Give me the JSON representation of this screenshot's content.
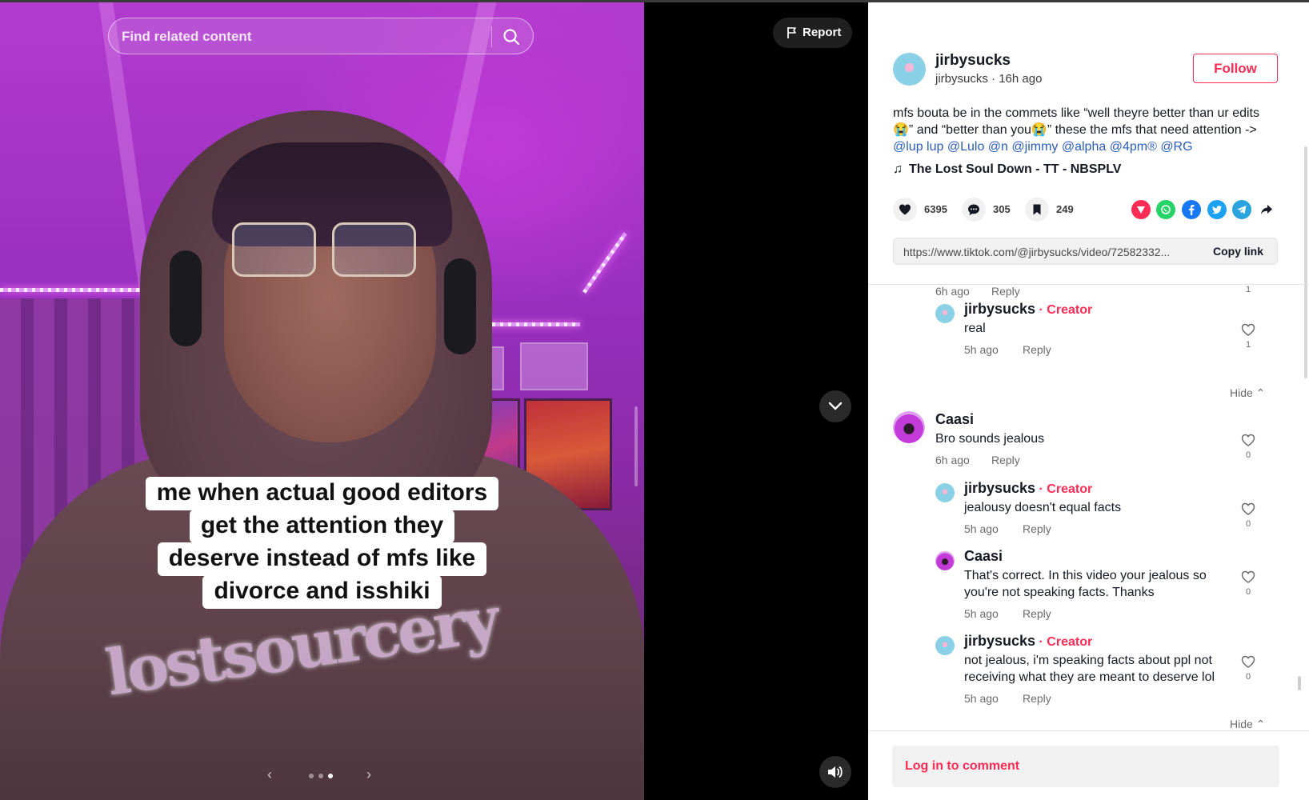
{
  "video": {
    "search_placeholder": "Find related content",
    "report_label": "Report",
    "caption_lines": [
      "me when actual good editors",
      "get the attention they",
      "deserve instead of mfs like",
      "divorce and isshiki"
    ],
    "hoodie_print": "lostsourcery",
    "photo_index": 3,
    "photo_count": 3
  },
  "post": {
    "author_name": "jirbysucks",
    "author_handle": "jirbysucks",
    "separator": " · ",
    "posted_ago": "16h ago",
    "follow_label": "Follow",
    "description_text": "mfs bouta be in the commets like “well theyre better than ur edits😭” and “better than you😭” these the mfs that need attention -> ",
    "mentions": [
      "@lup lup",
      "@Lulo",
      "@n",
      "@jimmy",
      "@alpha",
      "@4pm®",
      "@RG"
    ],
    "music_note": "♫",
    "music_title": "The Lost Soul Down - TT - NBSPLV",
    "likes": "6395",
    "comments": "305",
    "saves": "249",
    "link_url": "https://www.tiktok.com/@jirbysucks/video/72582332...",
    "copy_link_label": "Copy link"
  },
  "comments": {
    "c0": {
      "time": "6h ago",
      "reply": "Reply",
      "likes": "1"
    },
    "c1": {
      "name": "jirbysucks",
      "creator_tag": " · Creator",
      "text": "real",
      "time": "5h ago",
      "reply": "Reply",
      "likes": "1"
    },
    "hide1": "Hide ⌃",
    "c2": {
      "name": "Caasi",
      "text": "Bro sounds jealous",
      "time": "6h ago",
      "reply": "Reply",
      "likes": "0"
    },
    "c3": {
      "name": "jirbysucks",
      "creator_tag": " · Creator",
      "text": "jealousy doesn't equal facts",
      "time": "5h ago",
      "reply": "Reply",
      "likes": "0"
    },
    "c4": {
      "name": "Caasi",
      "text": "That's correct. In this video your jealous so you're not speaking facts. Thanks",
      "time": "5h ago",
      "reply": "Reply",
      "likes": "0"
    },
    "c5": {
      "name": "jirbysucks",
      "creator_tag": " · Creator",
      "text": "not jealous, i'm speaking facts about ppl not receiving what they are meant to deserve lol",
      "time": "5h ago",
      "reply": "Reply",
      "likes": "0"
    },
    "hide2": "Hide ⌃"
  },
  "footer": {
    "login_label": "Log in to comment"
  },
  "colors": {
    "accent": "#fe2c55",
    "mention": "#2b5db9",
    "panel_bg": "#ffffff",
    "video_bg": "#000000"
  },
  "icons": [
    "search-icon",
    "flag-icon",
    "chevron-down-icon",
    "volume-icon",
    "heart-icon",
    "comment-icon",
    "bookmark-icon",
    "tiktok-share-icon",
    "whatsapp-icon",
    "facebook-icon",
    "twitter-icon",
    "telegram-icon",
    "forward-icon",
    "music-note-icon"
  ]
}
